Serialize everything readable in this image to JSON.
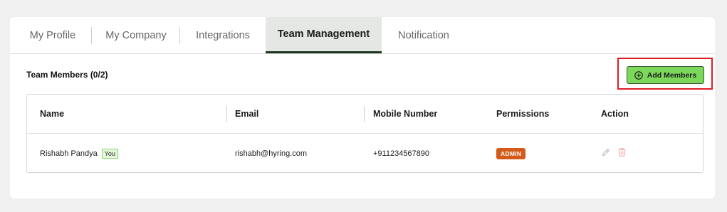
{
  "tabs": [
    {
      "label": "My Profile"
    },
    {
      "label": "My Company"
    },
    {
      "label": "Integrations"
    },
    {
      "label": "Team Management",
      "active": true
    },
    {
      "label": "Notification"
    }
  ],
  "section": {
    "title": "Team Members (0/2)",
    "add_button_label": "Add Members"
  },
  "table": {
    "headers": [
      "Name",
      "Email",
      "Mobile Number",
      "Permissions",
      "Action"
    ],
    "rows": [
      {
        "name": "Rishabh Pandya",
        "badge": "You",
        "email": "rishabh@hyring.com",
        "mobile": "+911234567890",
        "permission": "ADMIN",
        "actions": [
          "pencil-icon",
          "trash-icon"
        ]
      }
    ]
  },
  "colors": {
    "accent_green": "#7cd85a",
    "active_tab_underline": "#1c3822",
    "admin_badge": "#d35a19",
    "highlight_border": "#e01b24"
  }
}
